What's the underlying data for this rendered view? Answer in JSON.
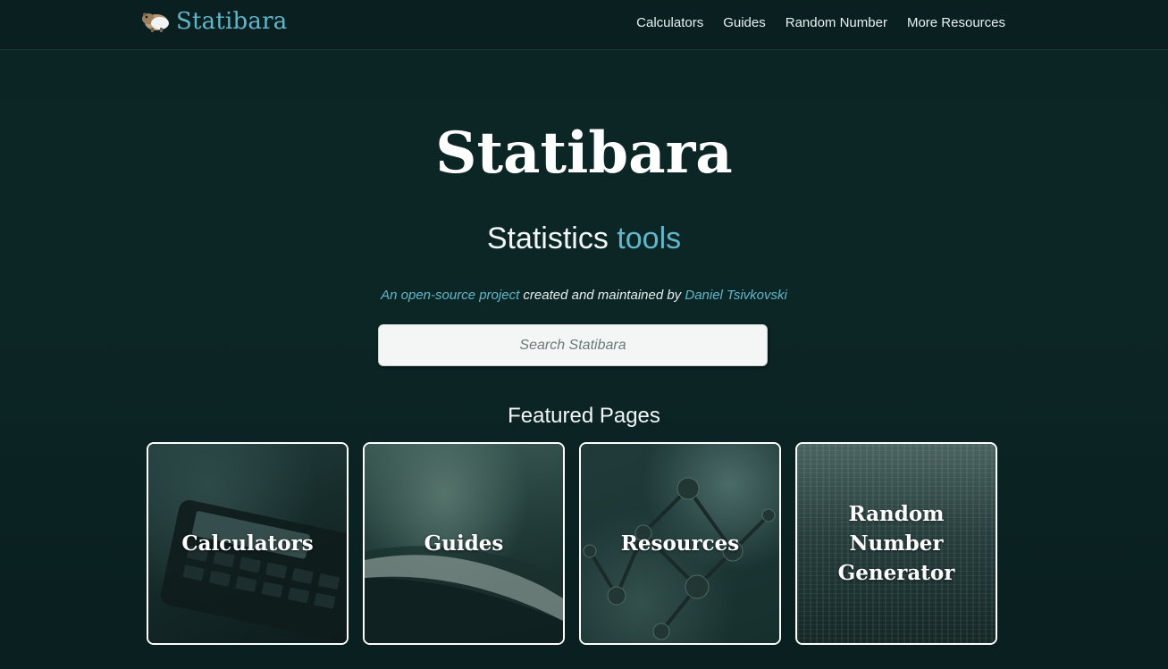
{
  "colors": {
    "accent": "#62b6cb",
    "background": "#0b2424"
  },
  "navbar": {
    "brand": "Statibara",
    "brand_icon": "capybara-logo-icon",
    "links": [
      {
        "label": "Calculators"
      },
      {
        "label": "Guides"
      },
      {
        "label": "Random Number"
      },
      {
        "label": "More Resources"
      }
    ]
  },
  "hero": {
    "title": "Statibara",
    "subtitle_main": "Statistics",
    "subtitle_accent": "tools",
    "credit_link1": "An open-source project",
    "credit_middle": " created and maintained by ",
    "credit_link2": "Daniel Tsivkovski"
  },
  "search": {
    "placeholder": "Search Statibara",
    "value": ""
  },
  "featured": {
    "title": "Featured Pages",
    "cards": [
      {
        "label": "Calculators",
        "image": "calculator-photo"
      },
      {
        "label": "Guides",
        "image": "book-pages-photo"
      },
      {
        "label": "Resources",
        "image": "molecule-network-photo"
      },
      {
        "label": "Random Number Generator",
        "image": "digital-code-photo"
      }
    ]
  }
}
